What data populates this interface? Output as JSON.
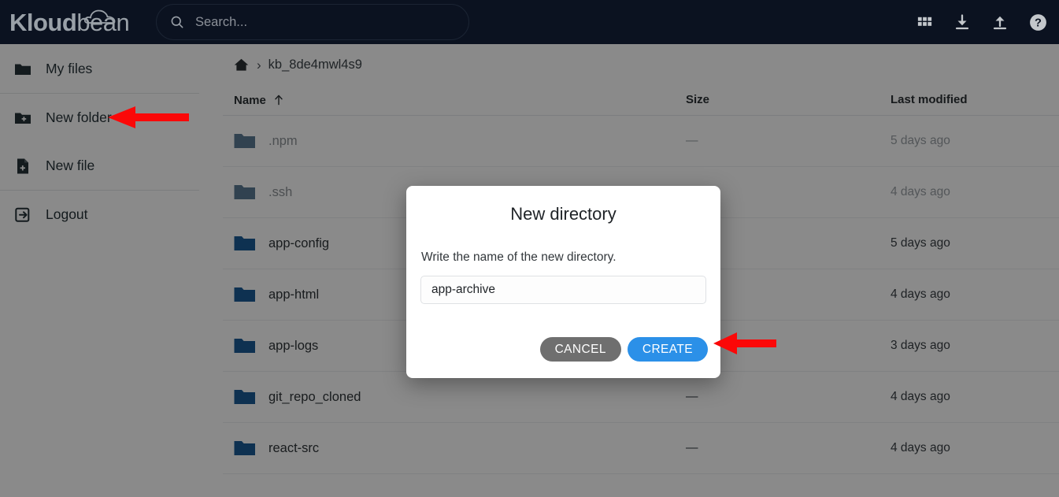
{
  "topbar": {
    "logo_bold": "Kloud",
    "logo_light": "bean",
    "search": {
      "placeholder": "Search...",
      "value": ""
    },
    "actions": [
      {
        "name": "apps-grid-icon"
      },
      {
        "name": "download-icon"
      },
      {
        "name": "upload-icon"
      },
      {
        "name": "help-icon"
      }
    ]
  },
  "sidebar": {
    "items": [
      {
        "label": "My files",
        "icon": "folder-icon"
      },
      {
        "label": "New folder",
        "icon": "folder-plus-icon"
      },
      {
        "label": "New file",
        "icon": "file-plus-icon"
      },
      {
        "label": "Logout",
        "icon": "logout-icon"
      }
    ]
  },
  "main": {
    "breadcrumb": {
      "home_icon": "home-icon",
      "separator": "›",
      "current": "kb_8de4mwl4s9"
    },
    "columns": {
      "name": "Name",
      "size": "Size",
      "modified": "Last modified",
      "sort_indicator": "ascending"
    },
    "rows": [
      {
        "name": ".npm",
        "size": "—",
        "modified": "5 days ago",
        "hidden": true
      },
      {
        "name": ".ssh",
        "size": "—",
        "modified": "4 days ago",
        "hidden": true
      },
      {
        "name": "app-config",
        "size": "—",
        "modified": "5 days ago",
        "hidden": false
      },
      {
        "name": "app-html",
        "size": "—",
        "modified": "4 days ago",
        "hidden": false
      },
      {
        "name": "app-logs",
        "size": "—",
        "modified": "3 days ago",
        "hidden": false
      },
      {
        "name": "git_repo_cloned",
        "size": "—",
        "modified": "4 days ago",
        "hidden": false
      },
      {
        "name": "react-src",
        "size": "—",
        "modified": "4 days ago",
        "hidden": false
      }
    ]
  },
  "modal": {
    "title": "New directory",
    "message": "Write the name of the new directory.",
    "input_value": "app-archive",
    "input_placeholder": "",
    "cancel_label": "CANCEL",
    "create_label": "CREATE"
  },
  "annotations": {
    "arrows": [
      {
        "name": "arrow-new-folder",
        "target": "New folder"
      },
      {
        "name": "arrow-create-button",
        "target": "CREATE"
      }
    ]
  },
  "colors": {
    "topbar_bg": "#0b1220",
    "folder_blue": "#1a5c96",
    "folder_muted": "#5c7b94",
    "create_blue": "#2b90e8",
    "cancel_gray": "#6f6f6f",
    "arrow_red": "#fb0808"
  }
}
